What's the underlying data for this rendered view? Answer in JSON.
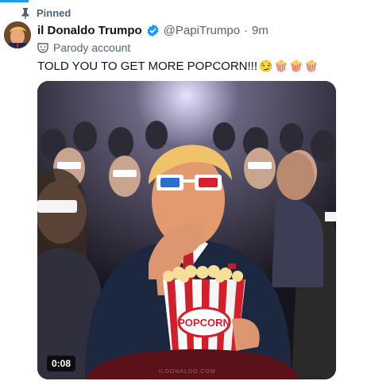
{
  "pinned": {
    "label": "Pinned",
    "icon": "pin-icon"
  },
  "author": {
    "display_name": "il Donaldo Trumpo",
    "handle": "@PapiTrumpo",
    "separator": "·",
    "time": "9m",
    "verified": true,
    "verified_color": "#1d9bf0"
  },
  "parody": {
    "label": "Parody account",
    "icon": "parody-mask-icon"
  },
  "tweet": {
    "text": "TOLD YOU TO GET MORE POPCORN!!!",
    "emojis": [
      "😏",
      "🍿",
      "🍿",
      "🍿"
    ]
  },
  "media": {
    "type": "video",
    "duration": "0:08",
    "popcorn_label": "POPCORN",
    "watermark": "ILDONALDO.COM"
  },
  "colors": {
    "accent": "#1d9bf0",
    "secondary_text": "#536471"
  }
}
